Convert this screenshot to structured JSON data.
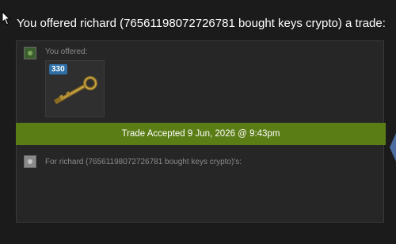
{
  "trade_offer": {
    "heading": "You offered richard (76561198072726781 bought keys crypto) a trade:",
    "you_offered_label": "You offered:",
    "item": {
      "count": "330",
      "icon": "key-icon"
    },
    "status_banner": "Trade Accepted 9 Jun, 2026 @ 9:43pm",
    "for_label": "For richard (76561198072726781 bought keys crypto)'s:"
  },
  "colors": {
    "background": "#1b1b1b",
    "panel": "#262626",
    "accepted_banner": "#5b7d16",
    "count_badge": "#2e6fa6",
    "nav_arrow": "#4a6c9e"
  }
}
